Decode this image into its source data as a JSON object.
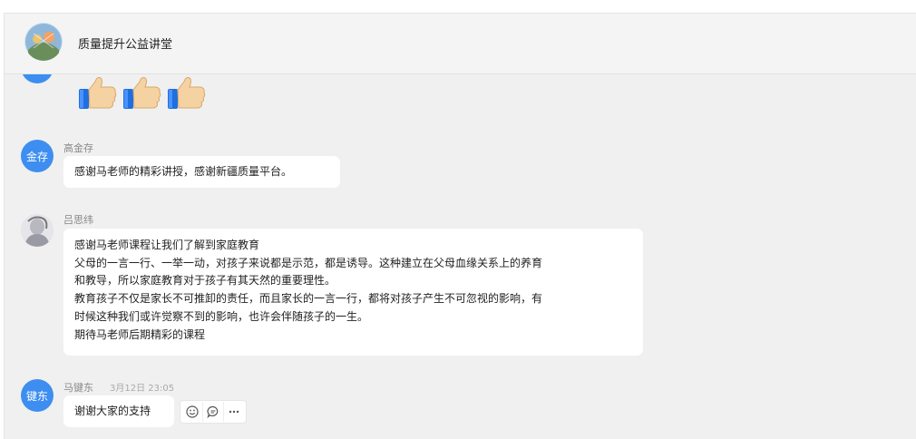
{
  "header": {
    "title": "质量提升公益讲堂"
  },
  "messages": [
    {
      "sender": "高金存",
      "avatar_text": "金存",
      "lines": [
        "感谢马老师的精彩讲授，感谢新疆质量平台。"
      ]
    },
    {
      "sender": "吕思纬",
      "avatar_text": "",
      "lines": [
        "感谢马老师课程让我们了解到家庭教育",
        "父母的一言一行、一举一动，对孩子来说都是示范，都是诱导。这种建立在父母血缘关系上的养育",
        "和教导，所以家庭教育对于孩子有其天然的重要理性。",
        "教育孩子不仅是家长不可推卸的责任，而且家长的一言一行，都将对孩子产生不可忽视的影响，有",
        "时候这种我们或许觉察不到的影响，也许会伴随孩子的一生。",
        "期待马老师后期精彩的课程"
      ]
    },
    {
      "sender": "马键东",
      "avatar_text": "键东",
      "time": "3月12日 23:05",
      "lines": [
        "谢谢大家的支持"
      ]
    }
  ],
  "actions": [
    "emoji-reaction",
    "reply",
    "more"
  ],
  "colors": {
    "avatar": "#3d8ef0",
    "background": "#f0f0f1"
  }
}
